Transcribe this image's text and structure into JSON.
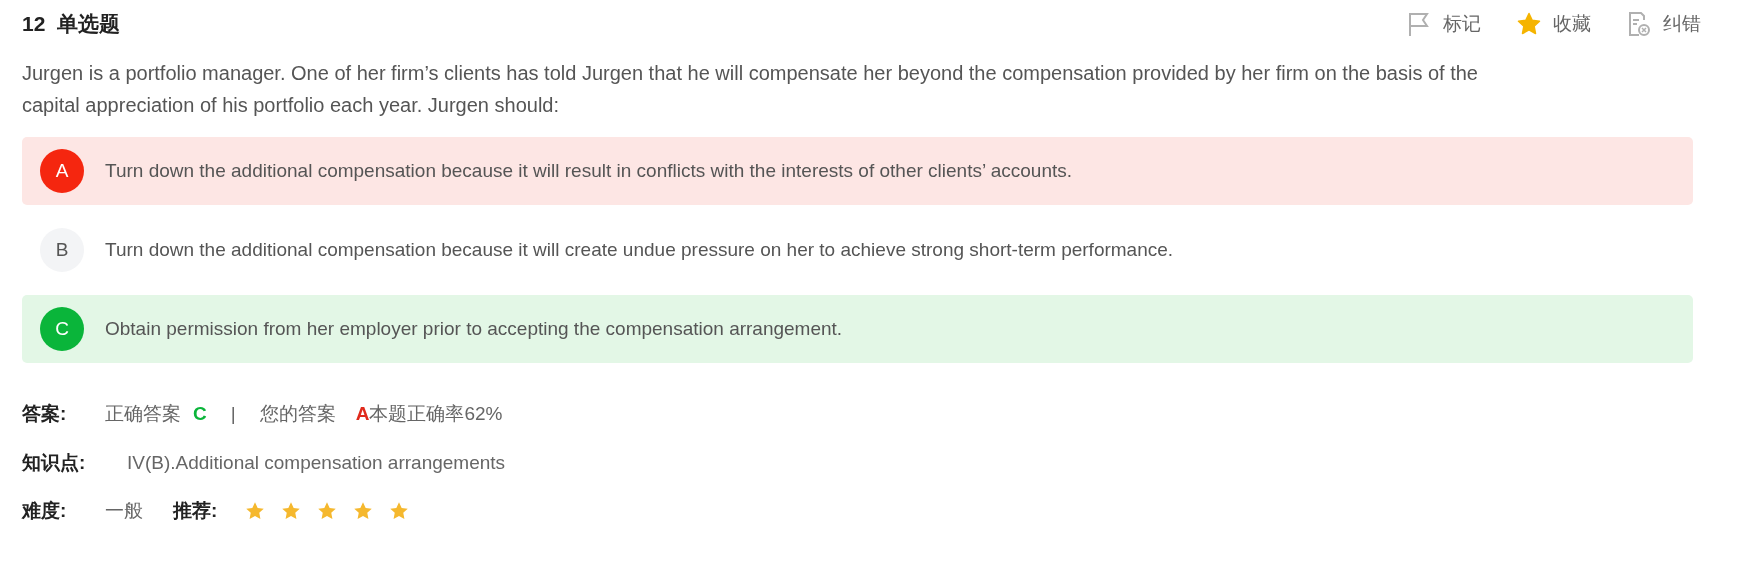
{
  "question": {
    "number": "12",
    "type": "单选题",
    "text": "Jurgen is a portfolio manager. One of her firm’s clients has told Jurgen that he will compensate her beyond the compensation provided by her firm on the basis of the capital appreciation of his portfolio each year. Jurgen should:"
  },
  "actions": [
    {
      "kind": "flag",
      "label": "标记",
      "on": false
    },
    {
      "kind": "star",
      "label": "收藏",
      "on": true
    },
    {
      "kind": "report",
      "label": "纠错",
      "on": false
    }
  ],
  "options": [
    {
      "letter": "A",
      "text": "Turn down the additional compensation because it will result in conflicts with the interests of other clients’ accounts.",
      "kind": "wrong"
    },
    {
      "letter": "B",
      "text": "Turn down the additional compensation because it will create undue pressure on her to achieve strong short-term performance.",
      "kind": "neutral"
    },
    {
      "letter": "C",
      "text": "Obtain permission from her employer prior to accepting the compensation arrangement.",
      "kind": "correct"
    }
  ],
  "answer": {
    "label": "答案:",
    "correct_label": "正确答案",
    "correct": "C",
    "separator": "|",
    "yours_label": "您的答案",
    "yours": "A",
    "accuracy": "本题正确率62%"
  },
  "knowledge": {
    "label": "知识点:",
    "value": "IV(B).Additional compensation arrangements"
  },
  "difficulty": {
    "label": "难度:",
    "value": "一般"
  },
  "recommend": {
    "label": "推荐:",
    "stars": 5
  }
}
